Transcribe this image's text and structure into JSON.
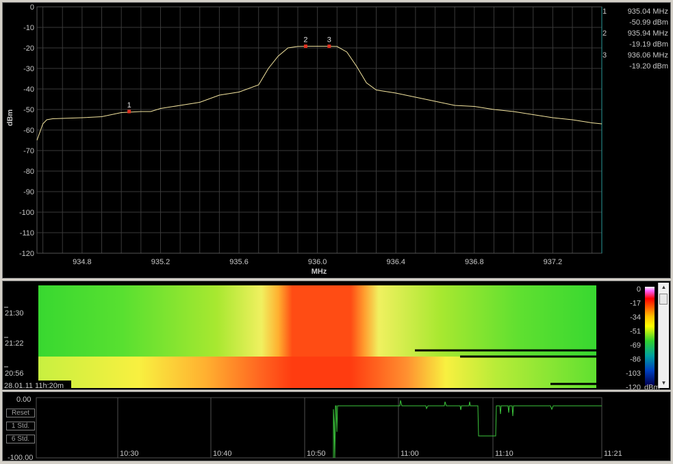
{
  "spectrum": {
    "ylabel": "dBm",
    "xlabel": "MHz",
    "y_ticks": [
      "0",
      "-10",
      "-20",
      "-30",
      "-40",
      "-50",
      "-60",
      "-70",
      "-80",
      "-90",
      "-100",
      "-110",
      "-120"
    ],
    "x_ticks": [
      "934.8",
      "935.2",
      "935.6",
      "936.0",
      "936.4",
      "936.8",
      "937.2"
    ],
    "markers": [
      {
        "num": "1",
        "freq": "935.04 MHz",
        "level": "-50.99 dBm"
      },
      {
        "num": "2",
        "freq": "935.94 MHz",
        "level": "-19.19 dBm"
      },
      {
        "num": "3",
        "freq": "936.06 MHz",
        "level": "-19.20 dBm"
      }
    ],
    "trace_color": "#f5e6a0",
    "marker_color": "#e03020"
  },
  "chart_data": {
    "type": "line",
    "title": "",
    "xlabel": "MHz",
    "ylabel": "dBm",
    "xlim": [
      934.57,
      937.45
    ],
    "ylim": [
      -120,
      0
    ],
    "grid": true,
    "series": [
      {
        "x": [
          934.57,
          934.6,
          934.62,
          934.65,
          934.8,
          934.9,
          935.0,
          935.1,
          935.15,
          935.2,
          935.3,
          935.4,
          935.5,
          935.6,
          935.7,
          935.75,
          935.8,
          935.85,
          935.9,
          935.95,
          936.0,
          936.05,
          936.1,
          936.15,
          936.2,
          936.25,
          936.3,
          936.4,
          936.5,
          936.6,
          936.7,
          936.8,
          936.9,
          937.0,
          937.1,
          937.2,
          937.3,
          937.4,
          937.45
        ],
        "y": [
          -65,
          -57,
          -55,
          -54.5,
          -54,
          -53.5,
          -51.5,
          -51,
          -51,
          -49.5,
          -48,
          -46.5,
          -43,
          -41.5,
          -38,
          -30,
          -24,
          -20,
          -19.3,
          -19.2,
          -19.2,
          -19.2,
          -19.3,
          -22,
          -29,
          -37,
          -40.5,
          -42,
          -44,
          -46,
          -48,
          -48.5,
          -50,
          -51,
          -52.5,
          -54,
          -55,
          -56.5,
          -57
        ]
      }
    ],
    "markers": [
      {
        "label": "1",
        "x": 935.04,
        "y": -50.99
      },
      {
        "label": "2",
        "x": 935.94,
        "y": -19.19
      },
      {
        "label": "3",
        "x": 936.06,
        "y": -19.2
      }
    ]
  },
  "waterfall": {
    "time_labels": [
      "21:30",
      "21:22",
      "20:56"
    ],
    "footer": "28.01.11 11h:20m",
    "scale_ticks": [
      "0",
      "-17",
      "-34",
      "-51",
      "-69",
      "-86",
      "-103",
      "-120 dBm"
    ]
  },
  "history": {
    "y_top": "0.00",
    "y_bottom": "-100.00",
    "buttons": [
      "Reset",
      "1 Std.",
      "6 Std."
    ],
    "time_ticks": [
      "10:30",
      "10:40",
      "10:50",
      "11:00",
      "11:10",
      "11:21"
    ],
    "trace_color": "#3cc83c"
  }
}
